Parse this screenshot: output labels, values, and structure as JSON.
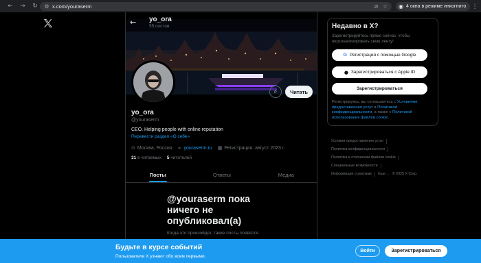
{
  "browser": {
    "url": "x.com/youraserm",
    "incognito_label": "4 окна в режиме инкогнито"
  },
  "header": {
    "name": "yo_ora",
    "post_count": "55 постов"
  },
  "profile": {
    "name": "yo_ora",
    "handle": "@youraserm",
    "bio": "CEO. Helping people with online reputation",
    "translate": "Перевести раздел «О себе»",
    "location": "Москва, Россия",
    "website": "youraserm.ru",
    "joined": "Регистрация: август 2023 г.",
    "following_count": "31",
    "following_label": "в читаемых",
    "followers_count": "5",
    "followers_label": "читателей",
    "follow_button": "Читать"
  },
  "tabs": [
    {
      "label": "Посты",
      "active": true
    },
    {
      "label": "Ответы",
      "active": false
    },
    {
      "label": "Медиа",
      "active": false
    }
  ],
  "empty_state": {
    "title": "@youraserm пока ничего не опубликовал(а)",
    "subtitle": "Когда это произойдет, такие посты появятся"
  },
  "signup_panel": {
    "title": "Недавно в X?",
    "description": "Зарегистрируйтесь прямо сейчас, чтобы персонализировать свою ленту!",
    "google_button": "Регистрация с помощью Google",
    "apple_button": "Зарегистрироваться с Apple ID",
    "register_button": "Зарегистрироваться",
    "legal_prefix": "Регистрируясь, вы соглашаетесь с",
    "legal_terms": "Условиями предоставления услуг",
    "legal_and": "и",
    "legal_privacy": "Политикой конфиденциальности",
    "legal_also": ", а также с",
    "legal_cookie": "Политикой использования файлов cookie",
    "legal_end": "."
  },
  "footer": {
    "links": [
      "Условия предоставления услуг",
      "Политика конфиденциальности",
      "Политика в отношении файлов cookie",
      "Специальные возможности",
      "Информация о рекламе",
      "Еще ...",
      "© 2025 X Corp."
    ]
  },
  "bottom_bar": {
    "title": "Будьте в курсе событий",
    "subtitle": "Пользователи X узнают обо всем первыми.",
    "login_button": "Войти",
    "register_button": "Зарегистрироваться"
  },
  "colors": {
    "accent": "#1d9bf0",
    "background": "#000000",
    "border": "#2f3336",
    "muted_text": "#71767b"
  }
}
